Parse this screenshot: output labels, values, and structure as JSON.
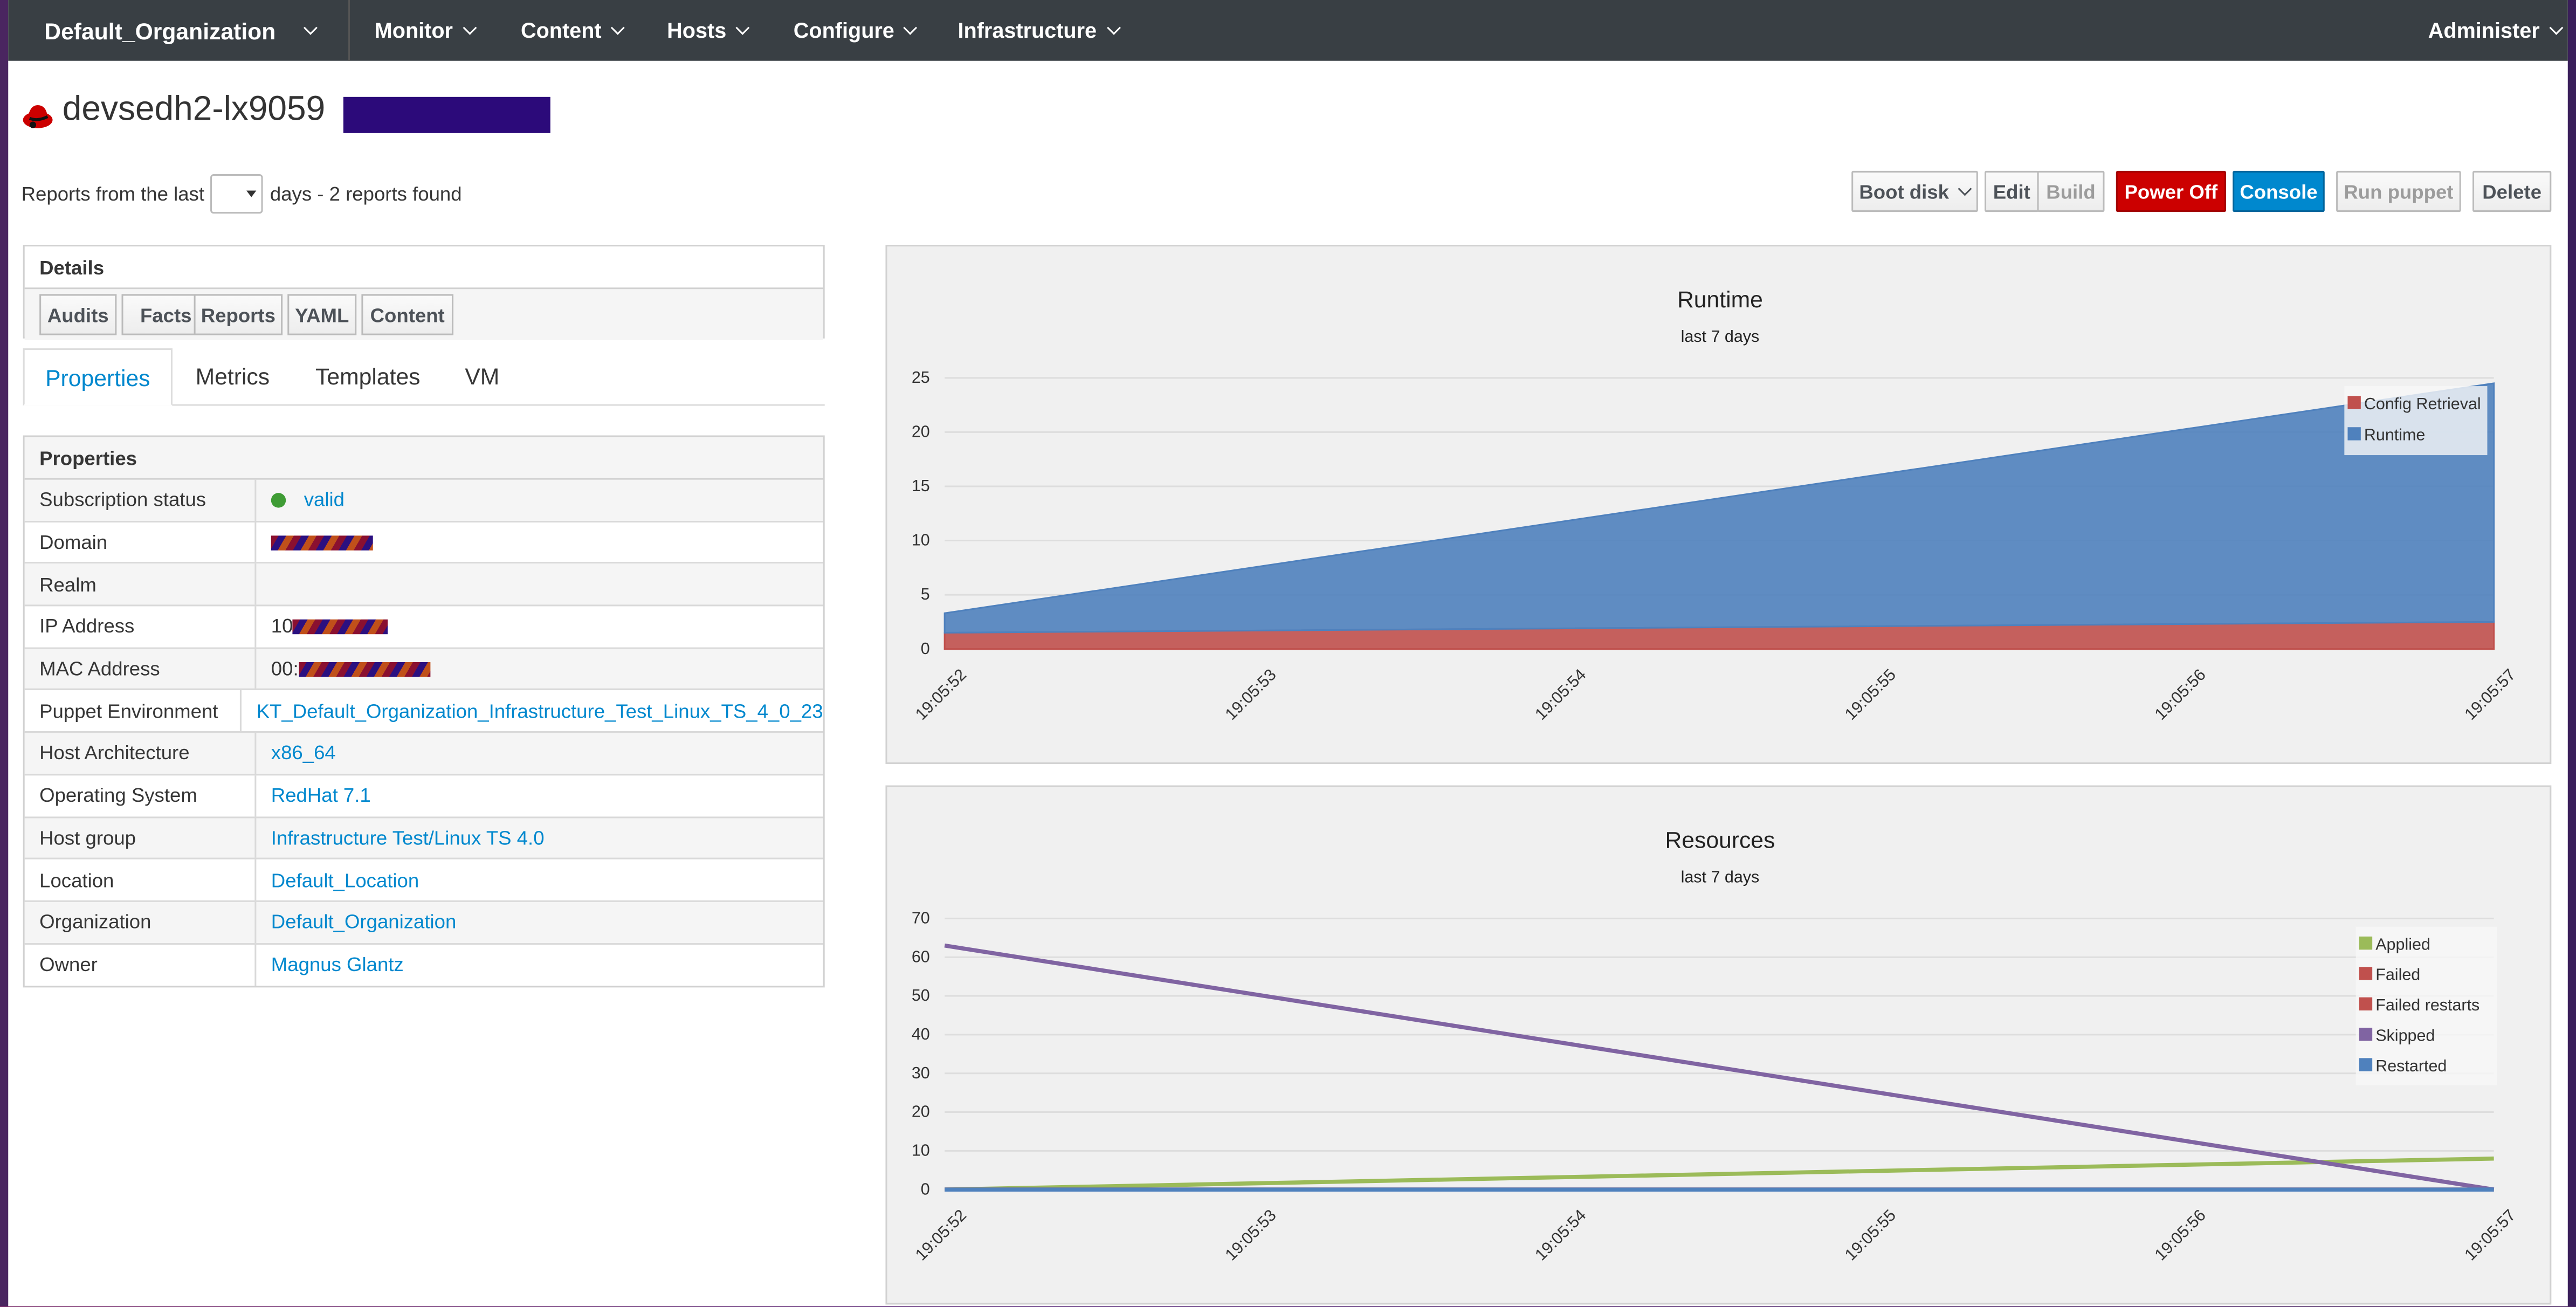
{
  "nav": {
    "org": "Default_Organization",
    "items": [
      "Monitor",
      "Content",
      "Hosts",
      "Configure",
      "Infrastructure"
    ],
    "admin": "Administer"
  },
  "host": {
    "title": "devsedh2-lx9059"
  },
  "reports": {
    "prefix": "Reports from the last",
    "suffix": "days - 2 reports found"
  },
  "actions": {
    "boot_disk": "Boot disk",
    "edit": "Edit",
    "build": "Build",
    "power_off": "Power Off",
    "console": "Console",
    "run_puppet": "Run puppet",
    "delete": "Delete"
  },
  "details": {
    "title": "Details",
    "buttons": [
      "Audits",
      "Facts",
      "Reports",
      "YAML",
      "Content"
    ]
  },
  "tabs": [
    "Properties",
    "Metrics",
    "Templates",
    "VM"
  ],
  "properties": {
    "title": "Properties",
    "rows": [
      {
        "key": "Subscription status",
        "value": "valid"
      },
      {
        "key": "Domain",
        "value": ""
      },
      {
        "key": "Realm",
        "value": ""
      },
      {
        "key": "IP Address",
        "value": "10"
      },
      {
        "key": "MAC Address",
        "value": "00:"
      },
      {
        "key": "Puppet Environment",
        "value": "KT_Default_Organization_Infrastructure_Test_Linux_TS_4_0_23"
      },
      {
        "key": "Host Architecture",
        "value": "x86_64"
      },
      {
        "key": "Operating System",
        "value": "RedHat 7.1"
      },
      {
        "key": "Host group",
        "value": "Infrastructure Test/Linux TS 4.0"
      },
      {
        "key": "Location",
        "value": "Default_Location"
      },
      {
        "key": "Organization",
        "value": "Default_Organization"
      },
      {
        "key": "Owner",
        "value": "Magnus Glantz"
      }
    ]
  },
  "colors": {
    "accent": "#0088ce",
    "danger": "#cc0000",
    "navbar": "#393f44",
    "status_ok": "#3f9c35"
  },
  "chart_data": [
    {
      "type": "area",
      "title": "Runtime",
      "subtitle": "last 7 days",
      "x": [
        "19:05:52",
        "19:05:53",
        "19:05:54",
        "19:05:55",
        "19:05:56",
        "19:05:57"
      ],
      "ylim": [
        0,
        25
      ],
      "yticks": [
        0,
        5,
        10,
        15,
        20,
        25
      ],
      "stacked": true,
      "legend": "top-right",
      "grid": true,
      "series": [
        {
          "name": "Config Retrieval",
          "color": "#c0504d",
          "x": [
            0,
            5
          ],
          "values": [
            1.5,
            2.5
          ]
        },
        {
          "name": "Runtime",
          "color": "#4f81bd",
          "x": [
            0,
            5
          ],
          "values": [
            1.8,
            22.0
          ]
        }
      ]
    },
    {
      "type": "line",
      "title": "Resources",
      "subtitle": "last 7 days",
      "x": [
        "19:05:52",
        "19:05:53",
        "19:05:54",
        "19:05:55",
        "19:05:56",
        "19:05:57"
      ],
      "ylim": [
        0,
        70
      ],
      "yticks": [
        0,
        10,
        20,
        30,
        40,
        50,
        60,
        70
      ],
      "legend": "top-right",
      "grid": true,
      "series": [
        {
          "name": "Applied",
          "color": "#9bbb59",
          "x": [
            0,
            5
          ],
          "values": [
            0,
            8
          ]
        },
        {
          "name": "Failed",
          "color": "#c0504d",
          "x": [
            0,
            5
          ],
          "values": [
            0,
            0
          ]
        },
        {
          "name": "Failed restarts",
          "color": "#c0504d",
          "x": [
            0,
            5
          ],
          "values": [
            0,
            0
          ]
        },
        {
          "name": "Skipped",
          "color": "#8064a2",
          "x": [
            0,
            5
          ],
          "values": [
            63,
            0
          ]
        },
        {
          "name": "Restarted",
          "color": "#4f81bd",
          "x": [
            0,
            5
          ],
          "values": [
            0,
            0
          ]
        }
      ]
    }
  ]
}
